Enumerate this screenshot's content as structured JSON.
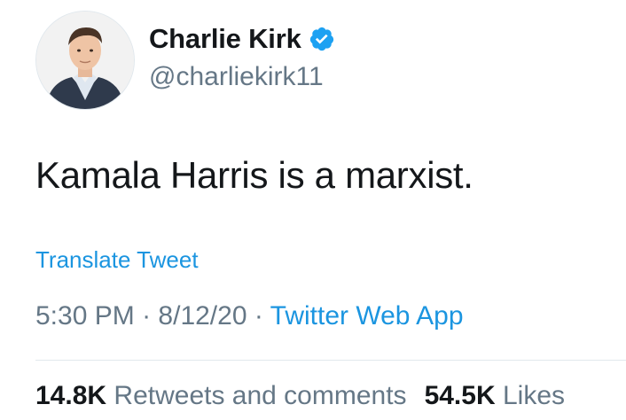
{
  "author": {
    "display_name": "Charlie Kirk",
    "handle": "@charliekirk11",
    "verified_icon": "verified-badge-icon"
  },
  "tweet": {
    "text": "Kamala Harris is a marxist.",
    "translate_label": "Translate Tweet"
  },
  "meta": {
    "time": "5:30 PM",
    "separator": "·",
    "date": "8/12/20",
    "source": "Twitter Web App"
  },
  "stats": {
    "retweets_count": "14.8K",
    "retweets_label": "Retweets and comments",
    "likes_count": "54.5K",
    "likes_label": "Likes"
  },
  "colors": {
    "link": "#1b95e0",
    "muted": "#657786",
    "text": "#14171a",
    "verified": "#1da1f2"
  }
}
